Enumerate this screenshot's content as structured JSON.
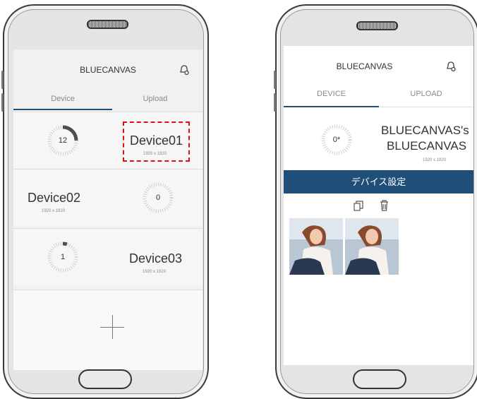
{
  "left_phone": {
    "app_title": "BLUECANVAS",
    "tabs": [
      {
        "label": "Device"
      },
      {
        "label": "Upload"
      }
    ],
    "devices": [
      {
        "name": "Device01",
        "resolution": "1920 x 1920",
        "count": "12",
        "progress": 0.25
      },
      {
        "name": "Device02",
        "resolution": "1920 x 1920",
        "count": "0",
        "progress": 0.0
      },
      {
        "name": "Device03",
        "resolution": "1920 x 1920",
        "count": "1",
        "progress": 0.05
      }
    ],
    "add_symbol": "+"
  },
  "right_phone": {
    "app_title": "BLUECANVAS",
    "tabs": [
      {
        "label": "DEVICE"
      },
      {
        "label": "UPLOAD"
      }
    ],
    "device": {
      "count": "0*",
      "name_line1": "BLUECANVAS's",
      "name_line2": "BLUECANVAS",
      "resolution": "1920 x 1920"
    },
    "settings_button": "デバイス設定"
  },
  "colors": {
    "accent": "#1f4e79",
    "highlight": "#e01010",
    "screen_bg": "#f1f1f1"
  },
  "icons": [
    "bell-icon",
    "copy-icon",
    "trash-icon",
    "plus-icon"
  ]
}
